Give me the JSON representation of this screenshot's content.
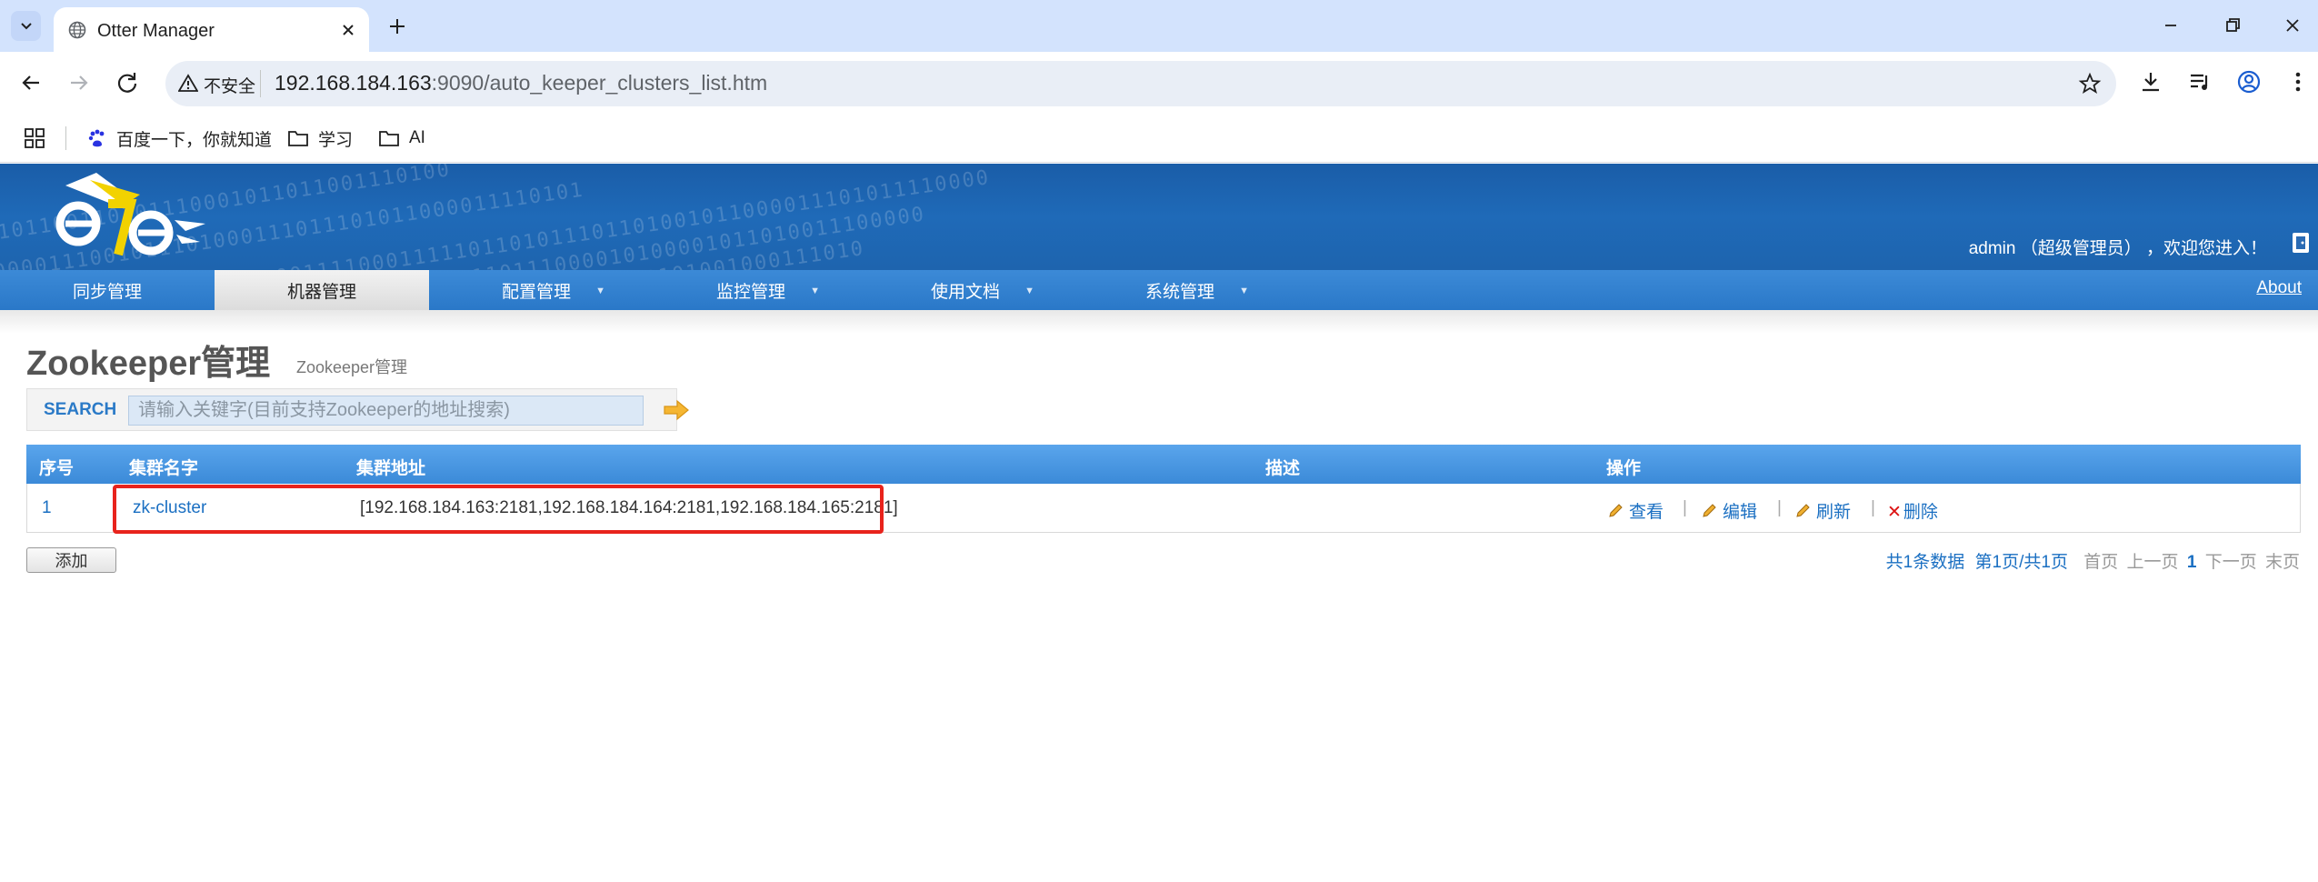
{
  "browser": {
    "tab_title": "Otter Manager",
    "insecure_label": "不安全",
    "url_host": "192.168.184.163",
    "url_rest": ":9090/auto_keeper_clusters_list.htm",
    "bookmarks": [
      "百度一下，你就知道",
      "学习",
      "AI"
    ]
  },
  "header": {
    "welcome": "admin （超级管理员） ，欢迎您进入！"
  },
  "nav": {
    "items": [
      "同步管理",
      "机器管理",
      "配置管理",
      "监控管理",
      "使用文档",
      "系统管理"
    ],
    "active": "机器管理",
    "about": "About"
  },
  "page": {
    "title": "Zookeeper管理",
    "subtitle": "Zookeeper管理"
  },
  "search": {
    "label": "SEARCH",
    "placeholder": "请输入关键字(目前支持Zookeeper的地址搜索)"
  },
  "table": {
    "columns": [
      "序号",
      "集群名字",
      "集群地址",
      "描述",
      "操作"
    ],
    "rows": [
      {
        "index": "1",
        "name": "zk-cluster",
        "address": "[192.168.184.163:2181,192.168.184.164:2181,192.168.184.165:2181]",
        "description": "",
        "actions": [
          "查看",
          "编辑",
          "刷新",
          "删除"
        ]
      }
    ],
    "action_separator": "|"
  },
  "footer": {
    "add_button": "添加",
    "summary": "共1条数据",
    "page_info": "第1页/共1页",
    "first": "首页",
    "prev": "上一页",
    "current": "1",
    "next": "下一页",
    "last": "末页"
  },
  "colors": {
    "banner": "#1f6ab8",
    "nav": "#2a78c8",
    "grid_header": "#3b8ad8",
    "link": "#1a6fc2",
    "highlight": "#e8231c"
  }
}
